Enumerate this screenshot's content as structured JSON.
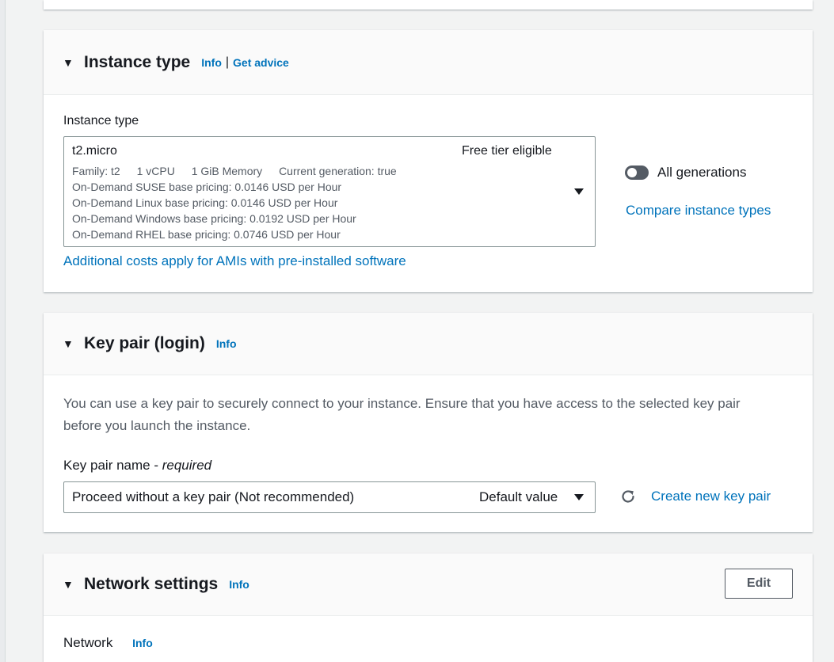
{
  "instance_type": {
    "title": "Instance type",
    "info": "Info",
    "separator": "|",
    "get_advice": "Get advice",
    "field_label": "Instance type",
    "selected": {
      "name": "t2.micro",
      "badge": "Free tier eligible",
      "family": "Family: t2",
      "vcpu": "1 vCPU",
      "memory": "1 GiB Memory",
      "generation": "Current generation: true",
      "pricing": [
        "On-Demand SUSE base pricing: 0.0146 USD per Hour",
        "On-Demand Linux base pricing: 0.0146 USD per Hour",
        "On-Demand Windows base pricing: 0.0192 USD per Hour",
        "On-Demand RHEL base pricing: 0.0746 USD per Hour"
      ]
    },
    "all_generations_label": "All generations",
    "all_generations_on": false,
    "compare_link": "Compare instance types",
    "additional_costs_link": "Additional costs apply for AMIs with pre-installed software"
  },
  "key_pair": {
    "title": "Key pair (login)",
    "info": "Info",
    "description_line1": "You can use a key pair to securely connect to your instance. Ensure that you have access to the selected key pair",
    "description_line2": "before you launch the instance.",
    "field_label": "Key pair name - ",
    "field_label_required": "required",
    "selected_value": "Proceed without a key pair (Not recommended)",
    "default_tag": "Default value",
    "create_link": "Create new key pair"
  },
  "network": {
    "title": "Network settings",
    "info": "Info",
    "edit_button": "Edit",
    "network_label": "Network",
    "network_info": "Info"
  },
  "colors": {
    "link": "#0073bb",
    "page_bg": "#f2f3f3",
    "header_bg": "#fafafa"
  }
}
